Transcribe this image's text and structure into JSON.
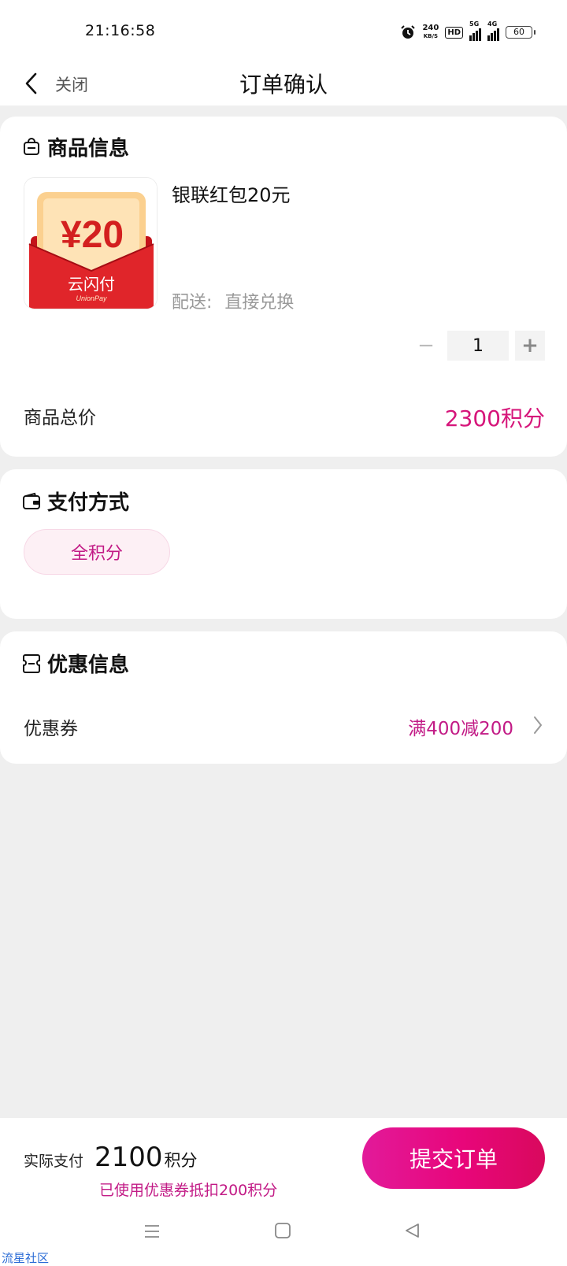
{
  "status_bar": {
    "time": "21:16:58",
    "net_speed": "240",
    "net_speed_unit": "KB/S",
    "hd_badge": "HD",
    "signal1_label": "5G",
    "signal2_label": "4G",
    "battery": "60",
    "icons": [
      "alarm-icon",
      "hd-icon",
      "signal-5g-icon",
      "signal-4g-icon",
      "battery-icon"
    ]
  },
  "nav": {
    "back_icon": "chevron-left-icon",
    "close_label": "关闭",
    "title": "订单确认"
  },
  "product_section": {
    "icon": "bag-icon",
    "title": "商品信息",
    "product": {
      "name": "银联红包20元",
      "thumb_amount": "¥20",
      "thumb_brand": "云闪付",
      "thumb_brand_en": "UnionPay",
      "delivery_label": "配送:",
      "delivery_value": "直接兑换",
      "quantity": "1",
      "minus_label": "−",
      "plus_label": "+"
    },
    "total_label": "商品总价",
    "total_value": "2300积分"
  },
  "payment_section": {
    "icon": "wallet-icon",
    "title": "支付方式",
    "selected_option": "全积分"
  },
  "discount_section": {
    "icon": "coupon-icon",
    "title": "优惠信息",
    "coupon_label": "优惠券",
    "coupon_value": "满400减200",
    "chevron_icon": "chevron-right-icon"
  },
  "bottom_bar": {
    "pay_label": "实际支付",
    "pay_amount": "2100",
    "pay_unit": "积分",
    "pay_note": "已使用优惠券抵扣200积分",
    "submit_label": "提交订单"
  },
  "system_nav": {
    "icons": [
      "menu-icon",
      "home-square-icon",
      "back-triangle-icon"
    ]
  },
  "watermark": "流星社区",
  "colors": {
    "accent": "#d6157a",
    "accent_text": "#c21b86",
    "background": "#efefef",
    "card": "#ffffff"
  }
}
